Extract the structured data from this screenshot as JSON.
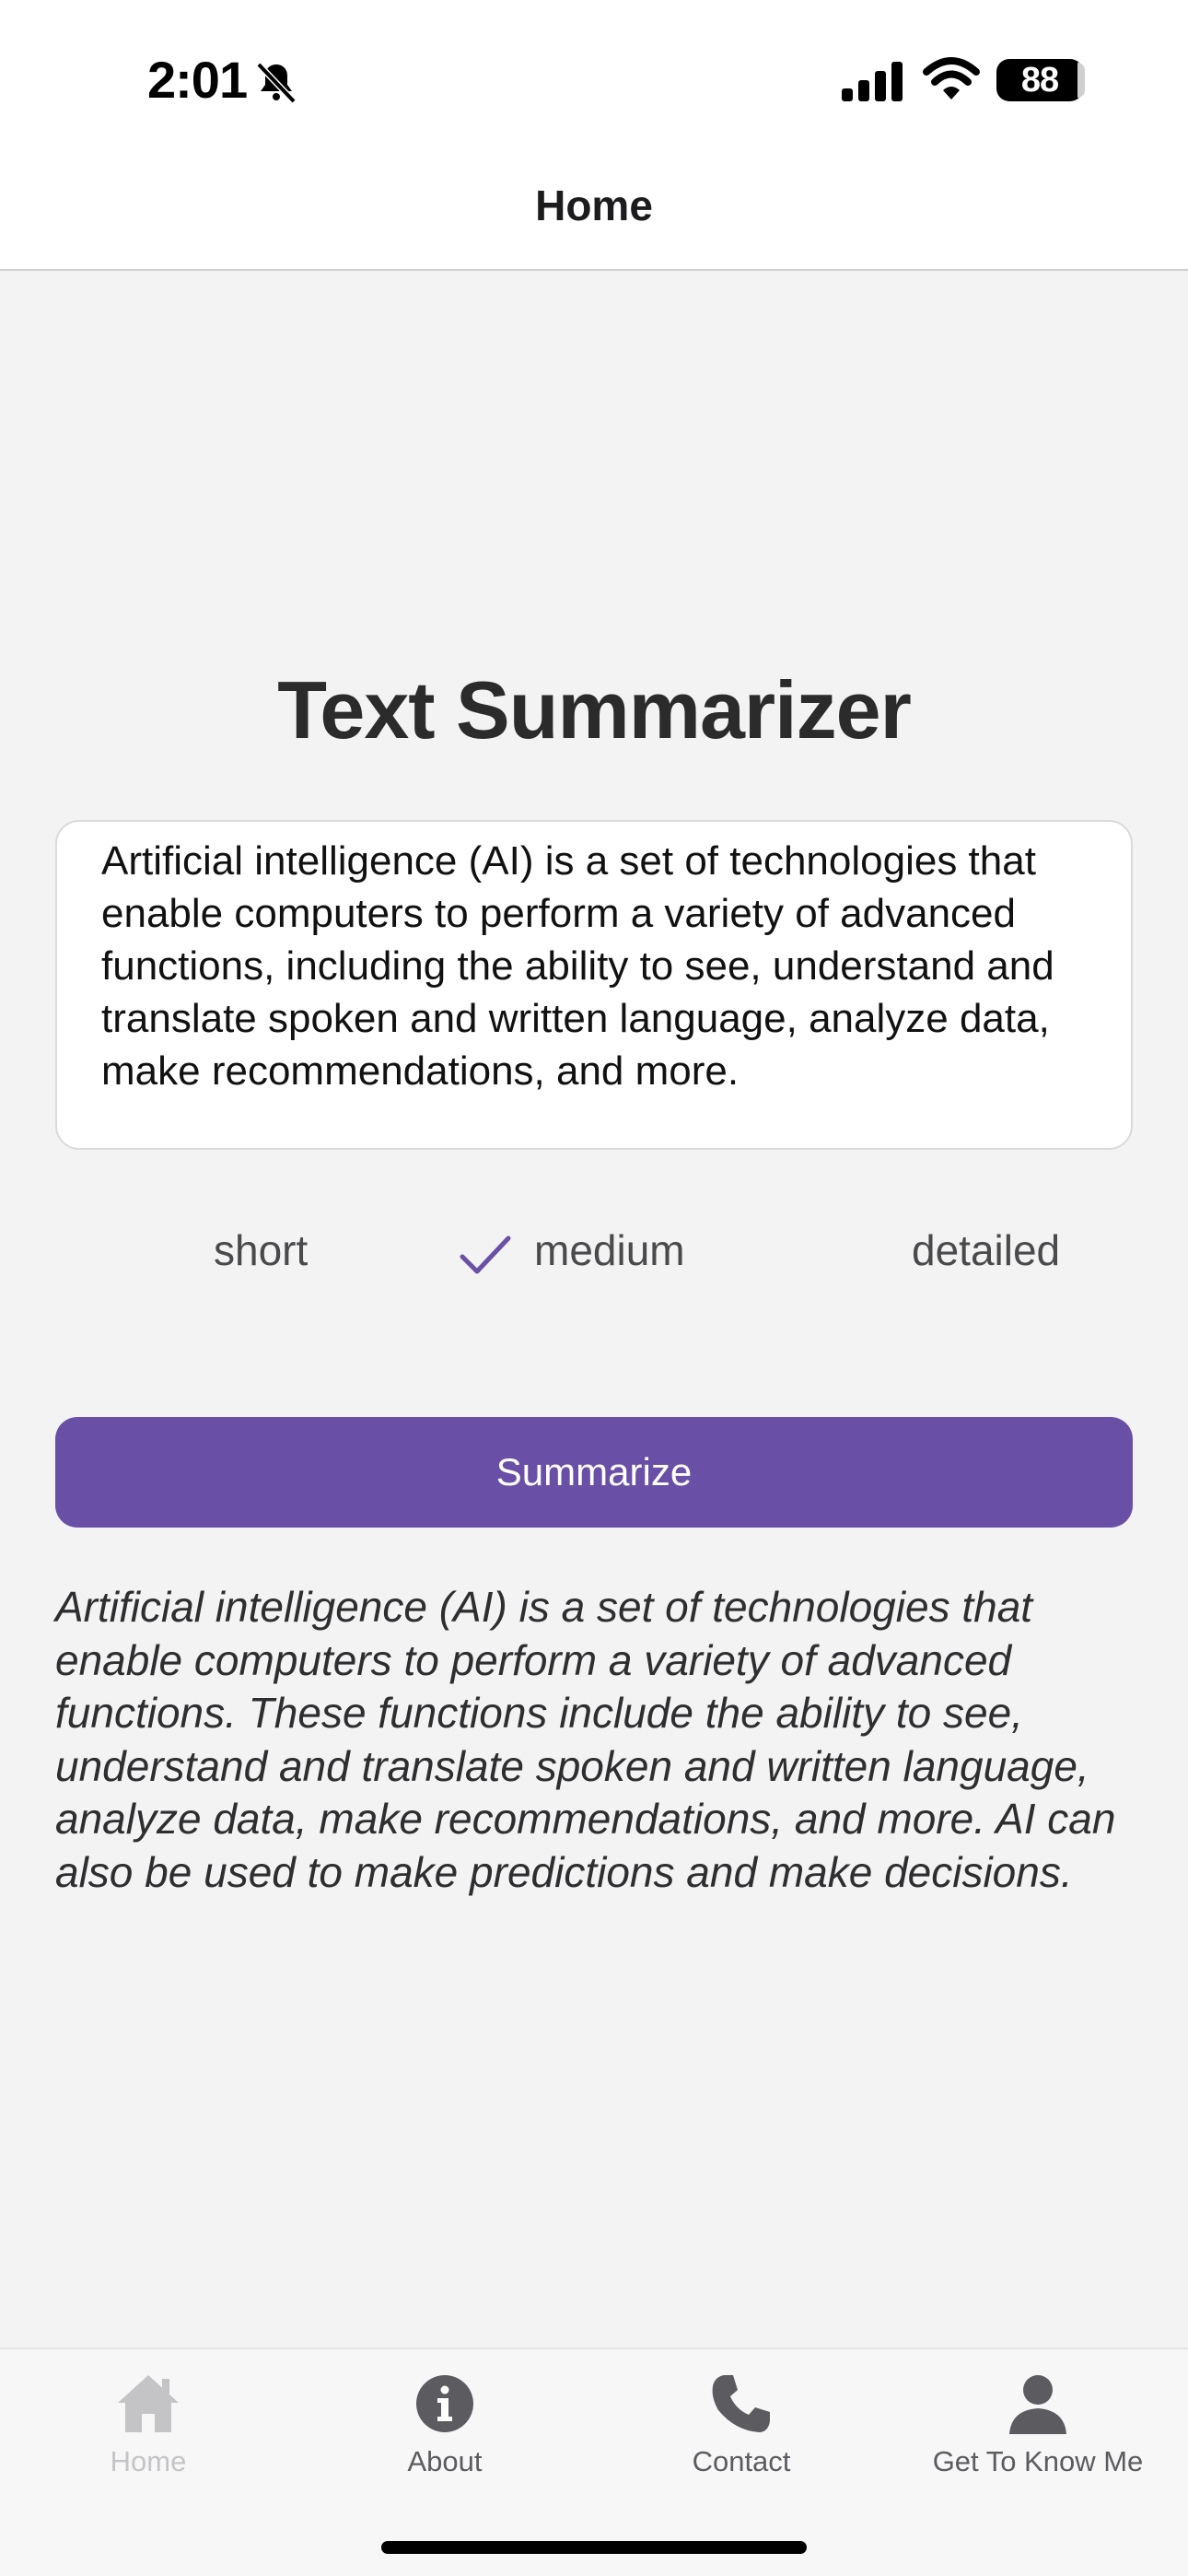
{
  "status_bar": {
    "time": "2:01",
    "battery": "88"
  },
  "header": {
    "title": "Home"
  },
  "main": {
    "title": "Text Summarizer",
    "input_text": "Artificial intelligence (AI) is a set of technologies that enable computers to perform a variety of advanced functions, including the ability to see, understand and translate spoken and written language, analyze data, make recommendations, and more.",
    "options": {
      "short": "short",
      "medium": "medium",
      "detailed": "detailed",
      "selected": "medium"
    },
    "button_label": "Summarize",
    "summary": "Artificial intelligence (AI) is a set of technologies that enable computers to perform a variety of advanced functions. These functions include the ability to see, understand and translate spoken and written language, analyze data, make recommendations, and more. AI can also be used to make predictions and make decisions."
  },
  "tabs": [
    {
      "label": "Home",
      "icon": "home-icon",
      "active": true
    },
    {
      "label": "About",
      "icon": "info-icon",
      "active": false
    },
    {
      "label": "Contact",
      "icon": "phone-icon",
      "active": false
    },
    {
      "label": "Get To Know Me",
      "icon": "person-icon",
      "active": false
    }
  ],
  "colors": {
    "accent": "#6a4fa6",
    "background": "#f3f3f4"
  }
}
